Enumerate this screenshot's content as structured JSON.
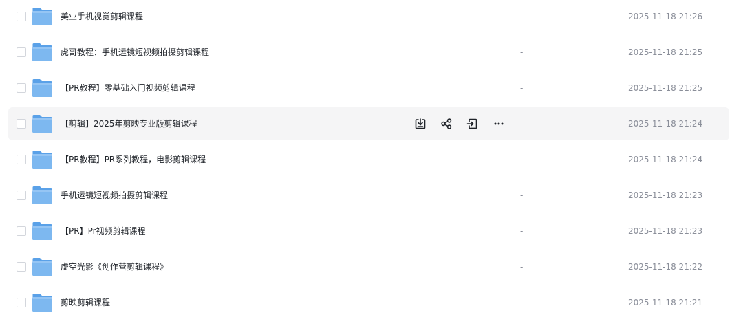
{
  "files": [
    {
      "name": "美业手机视觉剪辑课程",
      "size": "-",
      "modified": "2025-11-18 21:26"
    },
    {
      "name": "虎哥教程：手机运镜短视频拍摄剪辑课程",
      "size": "-",
      "modified": "2025-11-18 21:25"
    },
    {
      "name": "【PR教程】零基础入门视频剪辑课程",
      "size": "-",
      "modified": "2025-11-18 21:25"
    },
    {
      "name": "【剪辑】2025年剪映专业版剪辑课程",
      "size": "-",
      "modified": "2025-11-18 21:24"
    },
    {
      "name": "【PR教程】PR系列教程，电影剪辑课程",
      "size": "-",
      "modified": "2025-11-18 21:24"
    },
    {
      "name": "手机运镜短视频拍摄剪辑课程",
      "size": "-",
      "modified": "2025-11-18 21:23"
    },
    {
      "name": "【PR】Pr视频剪辑课程",
      "size": "-",
      "modified": "2025-11-18 21:23"
    },
    {
      "name": "虚空光影《创作营剪辑课程》",
      "size": "-",
      "modified": "2025-11-18 21:22"
    },
    {
      "name": "剪映剪辑课程",
      "size": "-",
      "modified": "2025-11-18 21:21"
    }
  ],
  "hovered_row": 3,
  "row_actions": [
    "download-icon",
    "share-icon",
    "move-icon",
    "more-icon"
  ],
  "colors": {
    "folder_body": "#7db8f0",
    "folder_tab": "#5aa1e8",
    "hover_bg": "#f5f5f6",
    "secondary_text": "#8a8e99"
  }
}
